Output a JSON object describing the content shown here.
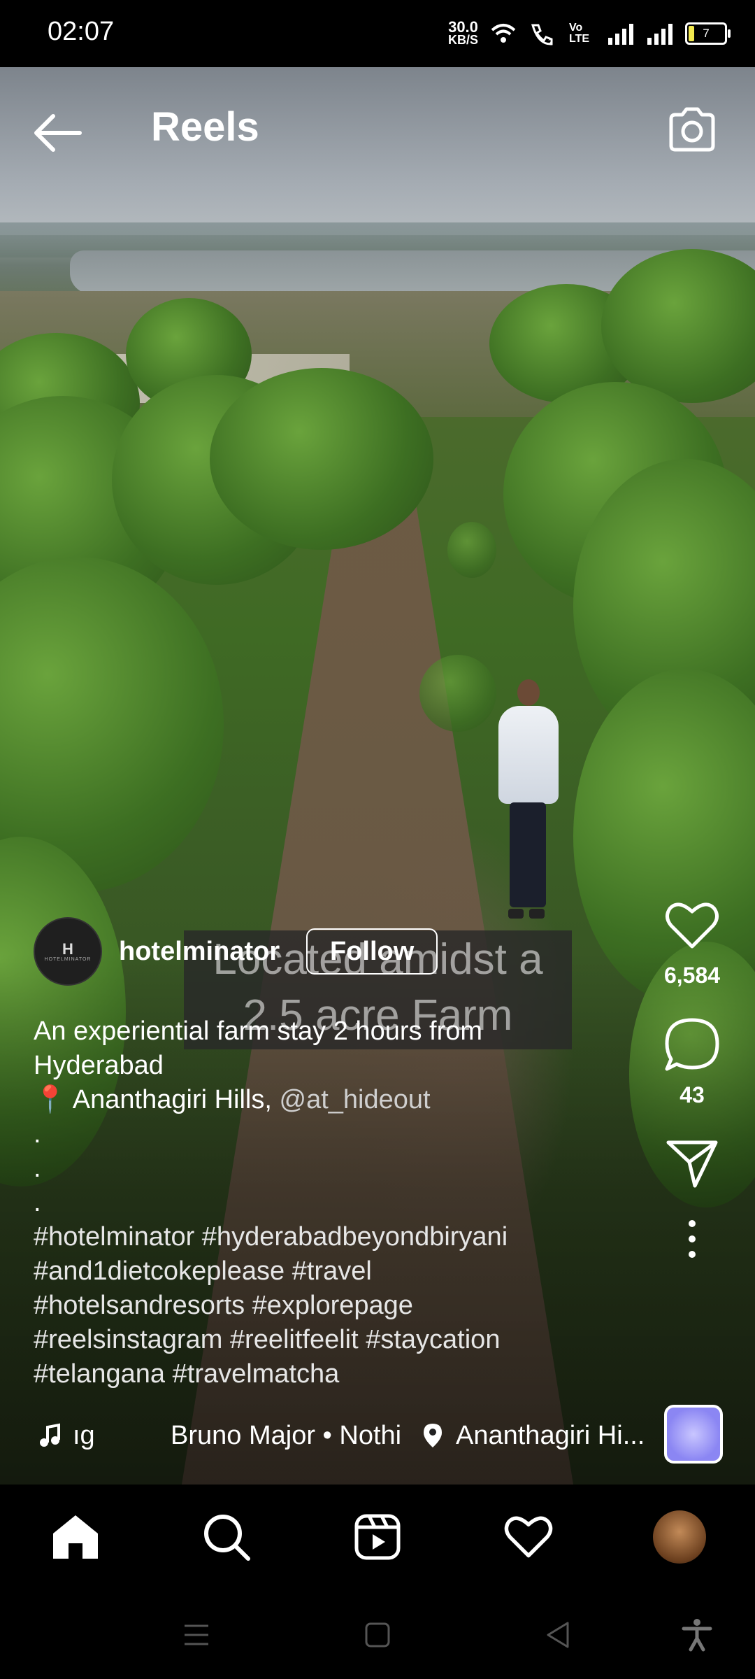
{
  "status_bar": {
    "time": "02:07",
    "net_speed_value": "30.0",
    "net_speed_unit": "KB/S",
    "volte": "Vo LTE",
    "battery": "7"
  },
  "header": {
    "title": "Reels",
    "back_icon": "back-arrow-icon",
    "camera_icon": "camera-icon"
  },
  "video_overlay_text": {
    "line1": "Located amidst a",
    "line2": "2.5 acre Farm"
  },
  "author": {
    "username": "hotelminator",
    "follow_label": "Follow",
    "avatar_mark": "H",
    "avatar_text": "HOTELMINATOR"
  },
  "caption": {
    "line1": "An experiential farm stay 2 hours from",
    "line2": "Hyderabad",
    "location_pin": "📍",
    "location_text": "Ananthagiri Hills,",
    "mention": "@at_hideout",
    "dot1": ".",
    "dot2": ".",
    "dot3": ".",
    "tags1": "#hotelminator #hyderabadbeyondbiryani",
    "tags2": "#and1dietcokeplease #travel",
    "tags3": "#hotelsandresorts #explorepage",
    "tags4": "#reelsinstagram #reelitfeelit #staycation",
    "tags5": "#telangana #travelmatcha"
  },
  "music": {
    "track_fragment": "ıg",
    "artist": "Bruno Major • Nothi",
    "location": "Ananthagiri Hi..."
  },
  "actions": {
    "likes": "6,584",
    "comments": "43"
  },
  "bottom_nav": {
    "items": [
      "home-icon",
      "search-icon",
      "reels-icon",
      "heart-icon",
      "profile-avatar"
    ]
  },
  "system_nav": {
    "items": [
      "menu-icon",
      "home-square-icon",
      "back-triangle-icon",
      "accessibility-icon"
    ]
  }
}
